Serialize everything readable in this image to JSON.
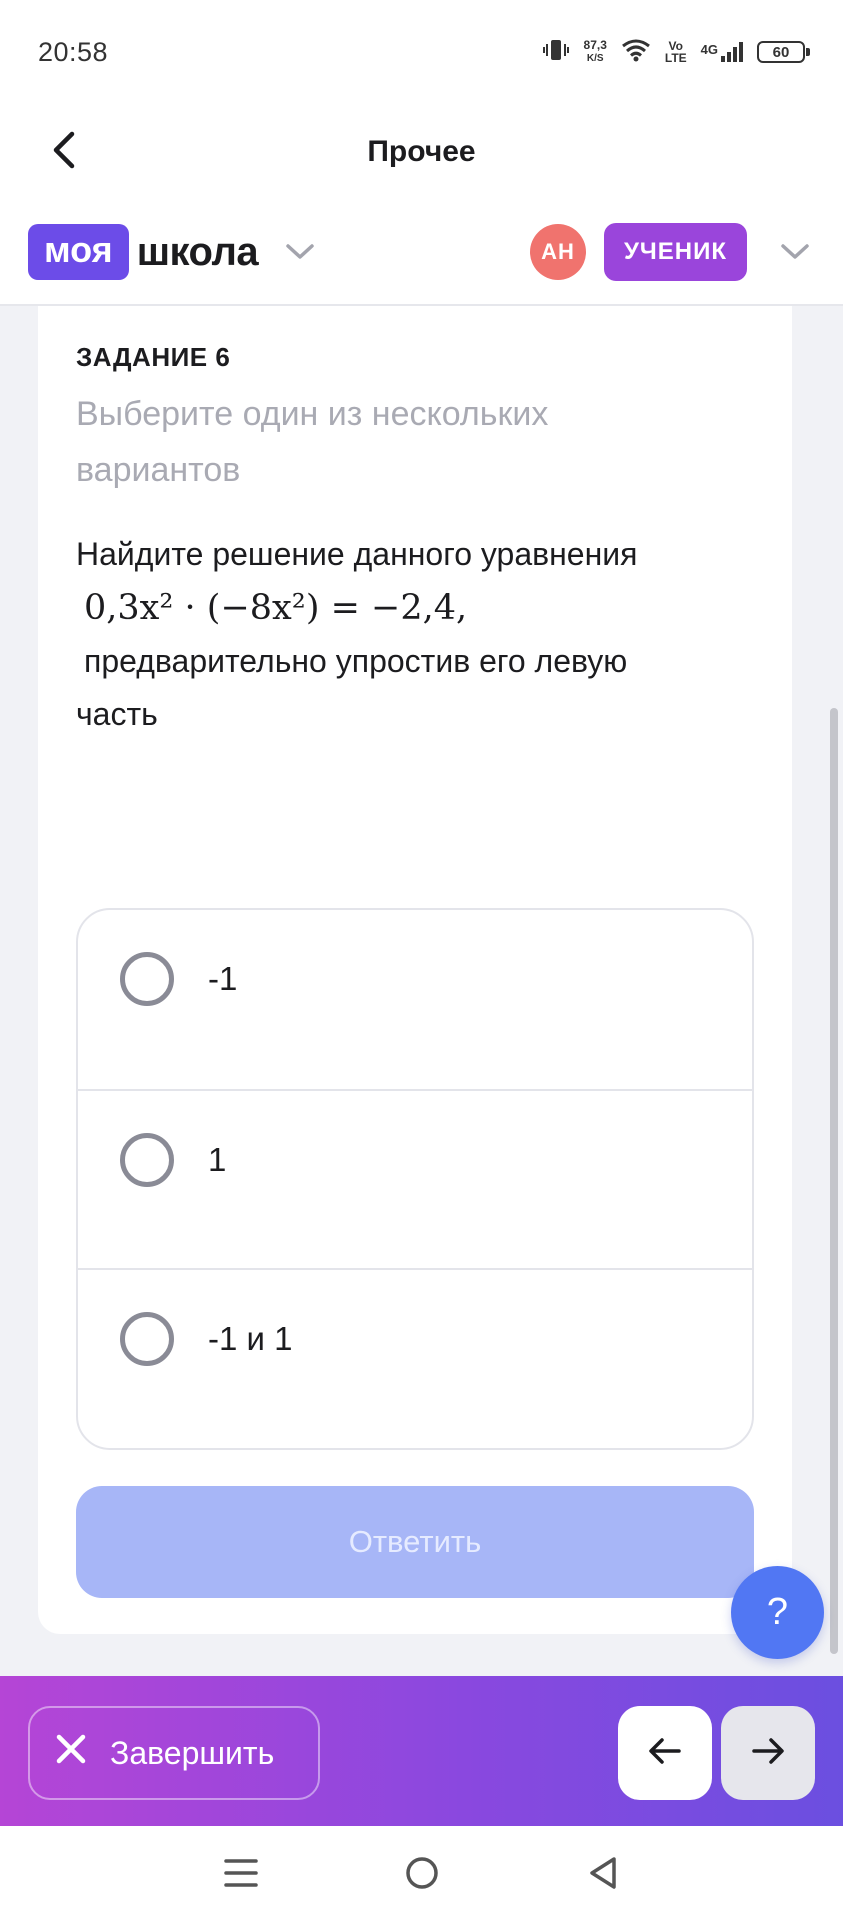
{
  "status_bar": {
    "time": "20:58",
    "net_speed_value": "87,3",
    "net_speed_unit": "K/S",
    "volte_top": "Vo",
    "volte_bottom": "LTE",
    "network": "4G",
    "battery": "60"
  },
  "header": {
    "title": "Прочее",
    "back_icon": "chevron-left-icon"
  },
  "school_bar": {
    "logo_part1": "моя",
    "logo_part2": "школа",
    "avatar_initials": "АН",
    "role": "УЧЕНИК",
    "colors": {
      "logo_bg": "#6c4ce8",
      "avatar_bg": "#f0736e",
      "role_bg": "#9a45db"
    }
  },
  "task": {
    "label": "ЗАДАНИЕ 6",
    "hint": "Выберите один из нескольких вариантов",
    "text_intro": "Найдите решение данного уравнения",
    "formula": "0,3x² · (−8x²) = −2,4,",
    "text_tail": "предварительно упростив его левую часть"
  },
  "options": [
    {
      "label": "-1",
      "selected": false
    },
    {
      "label": "1",
      "selected": false
    },
    {
      "label": "-1 и 1",
      "selected": false
    }
  ],
  "submit_label": "Ответить",
  "help_label": "?",
  "bottom_bar": {
    "finish_label": "Завершить",
    "prev_icon": "arrow-left-icon",
    "next_icon": "arrow-right-icon",
    "gradient": [
      "#b545d6",
      "#8a48df",
      "#6b4fe0"
    ]
  },
  "system_nav": {
    "icons": [
      "menu-icon",
      "home-icon",
      "back-triangle-icon"
    ]
  }
}
